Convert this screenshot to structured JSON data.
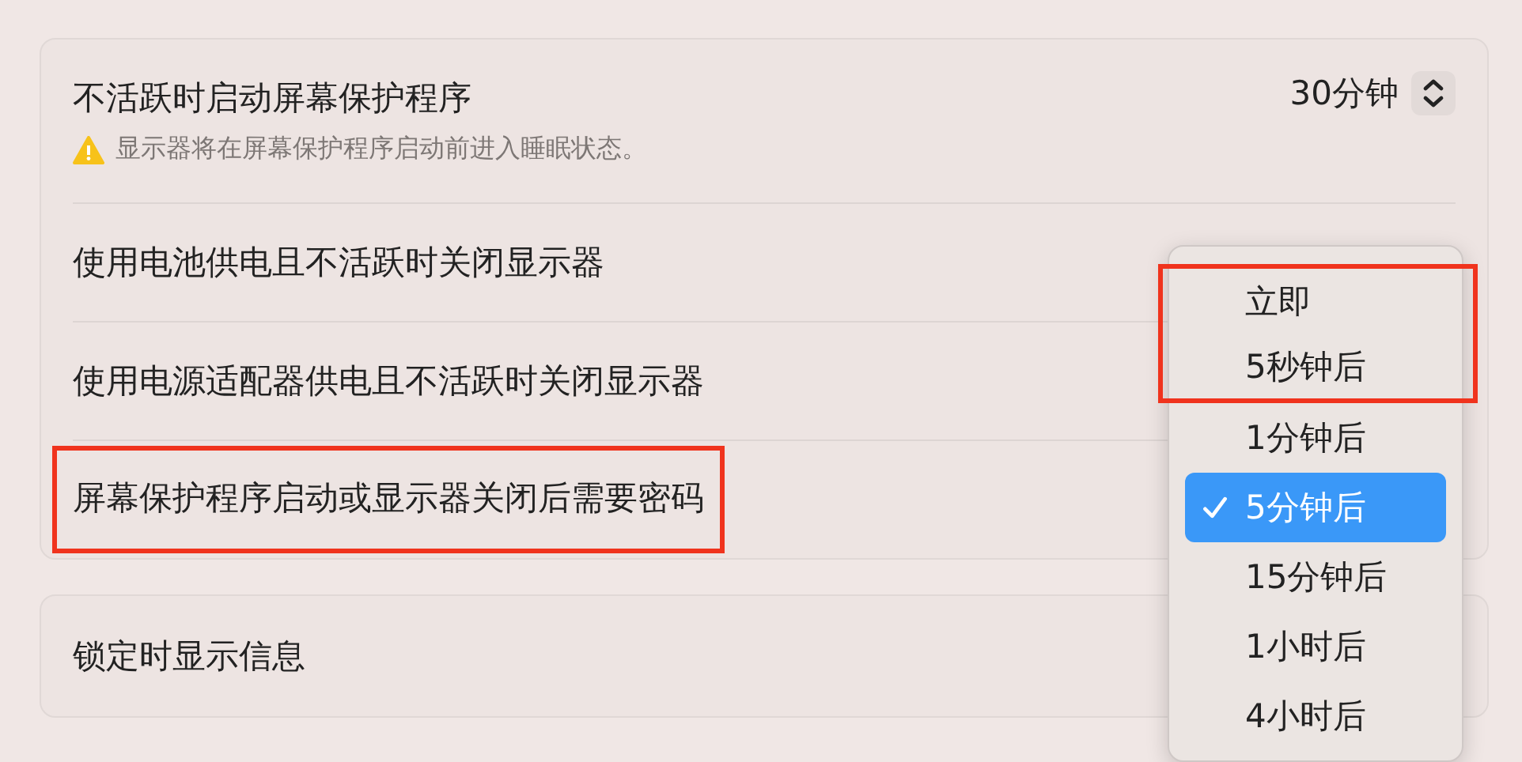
{
  "settings_card": {
    "rows": [
      {
        "label": "不活跃时启动屏幕保护程序",
        "warning": "显示器将在屏幕保护程序启动前进入睡眠状态。",
        "value": "30分钟",
        "highlighted": false
      },
      {
        "label": "使用电池供电且不活跃时关闭显示器",
        "highlighted": false
      },
      {
        "label": "使用电源适配器供电且不活跃时关闭显示器",
        "highlighted": false
      },
      {
        "label": "屏幕保护程序启动或显示器关闭后需要密码",
        "highlighted": true
      }
    ]
  },
  "lock_card": {
    "label": "锁定时显示信息"
  },
  "popup_menu": {
    "items": [
      {
        "label": "立即",
        "selected": false,
        "highlighted": true
      },
      {
        "label": "5秒钟后",
        "selected": false,
        "highlighted": true
      },
      {
        "label": "1分钟后",
        "selected": false,
        "highlighted": false
      },
      {
        "label": "5分钟后",
        "selected": true,
        "highlighted": false
      },
      {
        "label": "15分钟后",
        "selected": false,
        "highlighted": false
      },
      {
        "label": "1小时后",
        "selected": false,
        "highlighted": false
      },
      {
        "label": "4小时后",
        "selected": false,
        "highlighted": false
      }
    ]
  }
}
